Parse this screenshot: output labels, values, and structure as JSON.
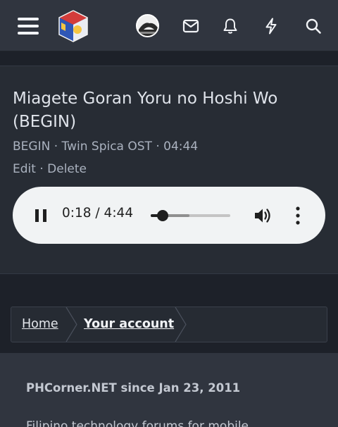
{
  "header": {
    "menu_icon": "hamburger-menu-icon",
    "logo_icon": "site-logo-cube",
    "avatar_icon": "user-avatar",
    "icons": [
      "envelope-icon",
      "bell-icon",
      "lightning-bolt-icon",
      "search-icon"
    ]
  },
  "media": {
    "title": "Miagete Goran Yoru no Hoshi Wo (BEGIN)",
    "meta": {
      "artist": "BEGIN",
      "album": "Twin Spica OST",
      "duration": "04:44",
      "separator": " · "
    },
    "actions": {
      "edit": "Edit",
      "delete": "Delete"
    }
  },
  "player": {
    "current_time": "0:18",
    "separator": " / ",
    "total_time": "4:44",
    "progress": 0.15,
    "buffered": 0.49,
    "play_state_icon": "pause-icon",
    "volume_icon": "volume-icon",
    "more_icon": "more-vertical-icon"
  },
  "breadcrumb": {
    "items": [
      "Home",
      "Your account"
    ]
  },
  "footer": {
    "since": "PHCorner.NET since Jan 23, 2011",
    "tagline": "Filipino technology forums for mobile"
  },
  "colors": {
    "background": "#1d2129",
    "header": "#30353f",
    "card": "#272c34",
    "player": "#f1f3f4",
    "text": "#dfe3ea"
  }
}
